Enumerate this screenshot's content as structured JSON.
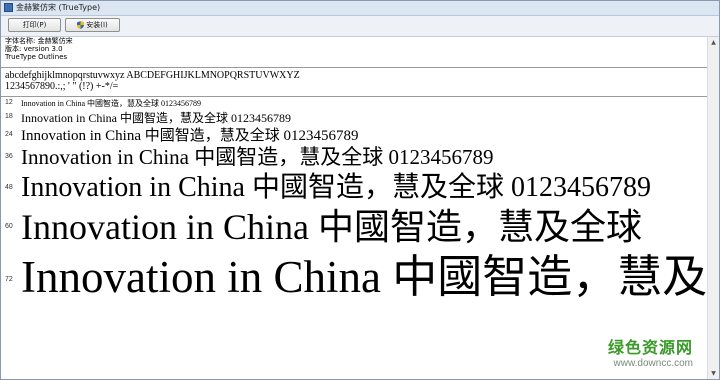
{
  "window": {
    "title": "金赫繁仿宋 (TrueType)"
  },
  "toolbar": {
    "print_label": "打印(P)",
    "install_label": "安装(I)"
  },
  "font_info": {
    "name_line": "字体名称: 金赫繁仿宋",
    "version_line": "版本: version 3.0",
    "type_line": "TrueType Outlines"
  },
  "alphabet": {
    "letters": "abcdefghijklmnopqrstuvwxyz ABCDEFGHIJKLMNOPQRSTUVWXYZ",
    "digits": "1234567890.:,; ' \" (!?) +-*/="
  },
  "samples": [
    {
      "size": "12",
      "text": "Innovation in China 中國智造，慧及全球 0123456789"
    },
    {
      "size": "18",
      "text": "Innovation in China 中國智造，慧及全球 0123456789"
    },
    {
      "size": "24",
      "text": "Innovation in China 中國智造，慧及全球 0123456789"
    },
    {
      "size": "36",
      "text": "Innovation in China 中國智造，慧及全球 0123456789"
    },
    {
      "size": "48",
      "text": "Innovation in China 中國智造，慧及全球 0123456789"
    },
    {
      "size": "60",
      "text": "Innovation in China 中國智造，慧及全球"
    },
    {
      "size": "72",
      "text": "Innovation in China 中國智造，慧及"
    }
  ],
  "watermark": {
    "main": "绿色资源网",
    "url": "www.downcc.com",
    "color": "#3a9a2a"
  }
}
